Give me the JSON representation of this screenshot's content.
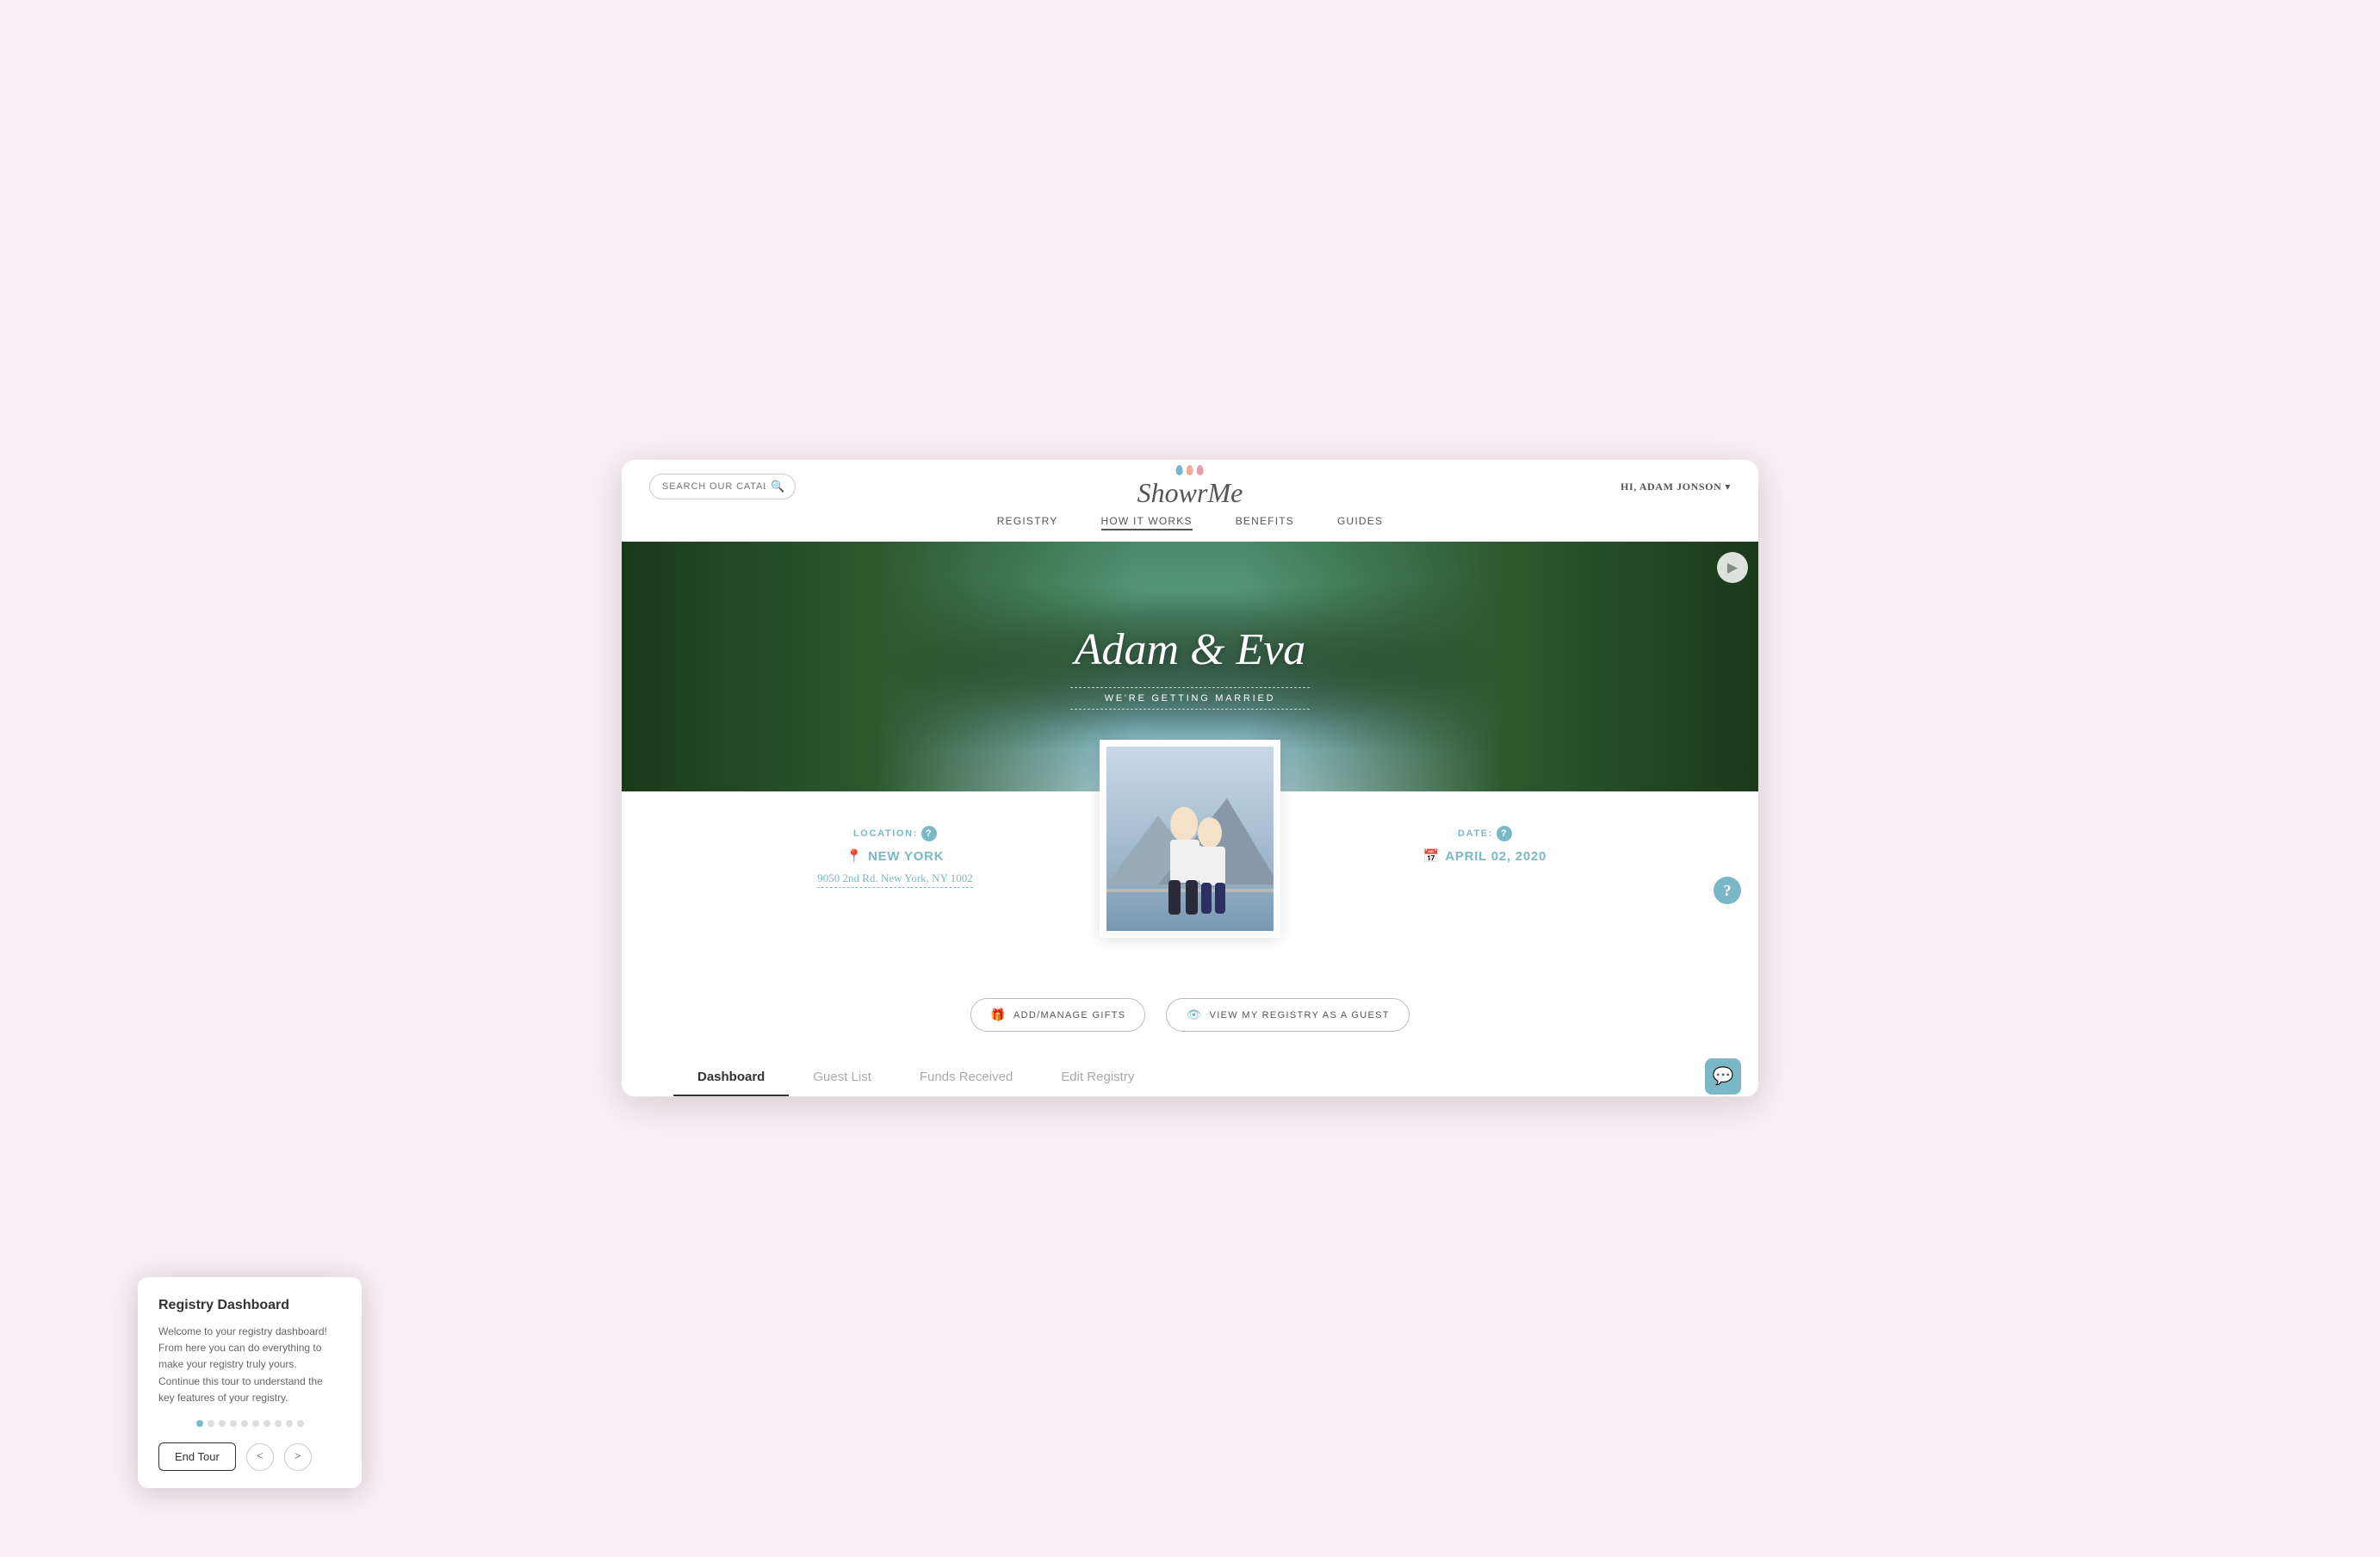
{
  "site": {
    "logo": "ShowrMe",
    "search_placeholder": "SEARCH OUR CATALOG"
  },
  "user": {
    "greeting": "HI, ADAM JONSON",
    "dropdown_icon": "▾"
  },
  "nav": {
    "items": [
      {
        "label": "REGISTRY",
        "active": false
      },
      {
        "label": "HOW IT WORKS",
        "active": true
      },
      {
        "label": "BENEFITS",
        "active": false
      },
      {
        "label": "GUIDES",
        "active": false
      }
    ]
  },
  "hero": {
    "title": "Adam & Eva",
    "subtitle": "WE'RE GETTING MARRIED"
  },
  "location": {
    "label": "LOCATION:",
    "city": "NEW YORK",
    "address": "9050 2nd Rd. New York, NY 1002"
  },
  "date": {
    "label": "DATE:",
    "value": "APRIL 02, 2020"
  },
  "buttons": {
    "add_gifts": "ADD/MANAGE GIFTS",
    "view_guest": "VIEW MY REGISTRY AS A GUEST"
  },
  "tabs": [
    {
      "label": "Dashboard",
      "active": true
    },
    {
      "label": "Guest List",
      "active": false
    },
    {
      "label": "Funds Received",
      "active": false
    },
    {
      "label": "Edit Registry",
      "active": false
    }
  ],
  "tour": {
    "title": "Registry Dashboard",
    "body": "Welcome to your registry dashboard! From here you can do everything to make your registry truly yours. Continue this tour to understand the key features of your registry.",
    "dots": [
      1,
      2,
      3,
      4,
      5,
      6,
      7,
      8,
      9,
      10
    ],
    "active_dot": 1,
    "end_btn": "End Tour",
    "prev_arrow": "<",
    "next_arrow": ">"
  }
}
